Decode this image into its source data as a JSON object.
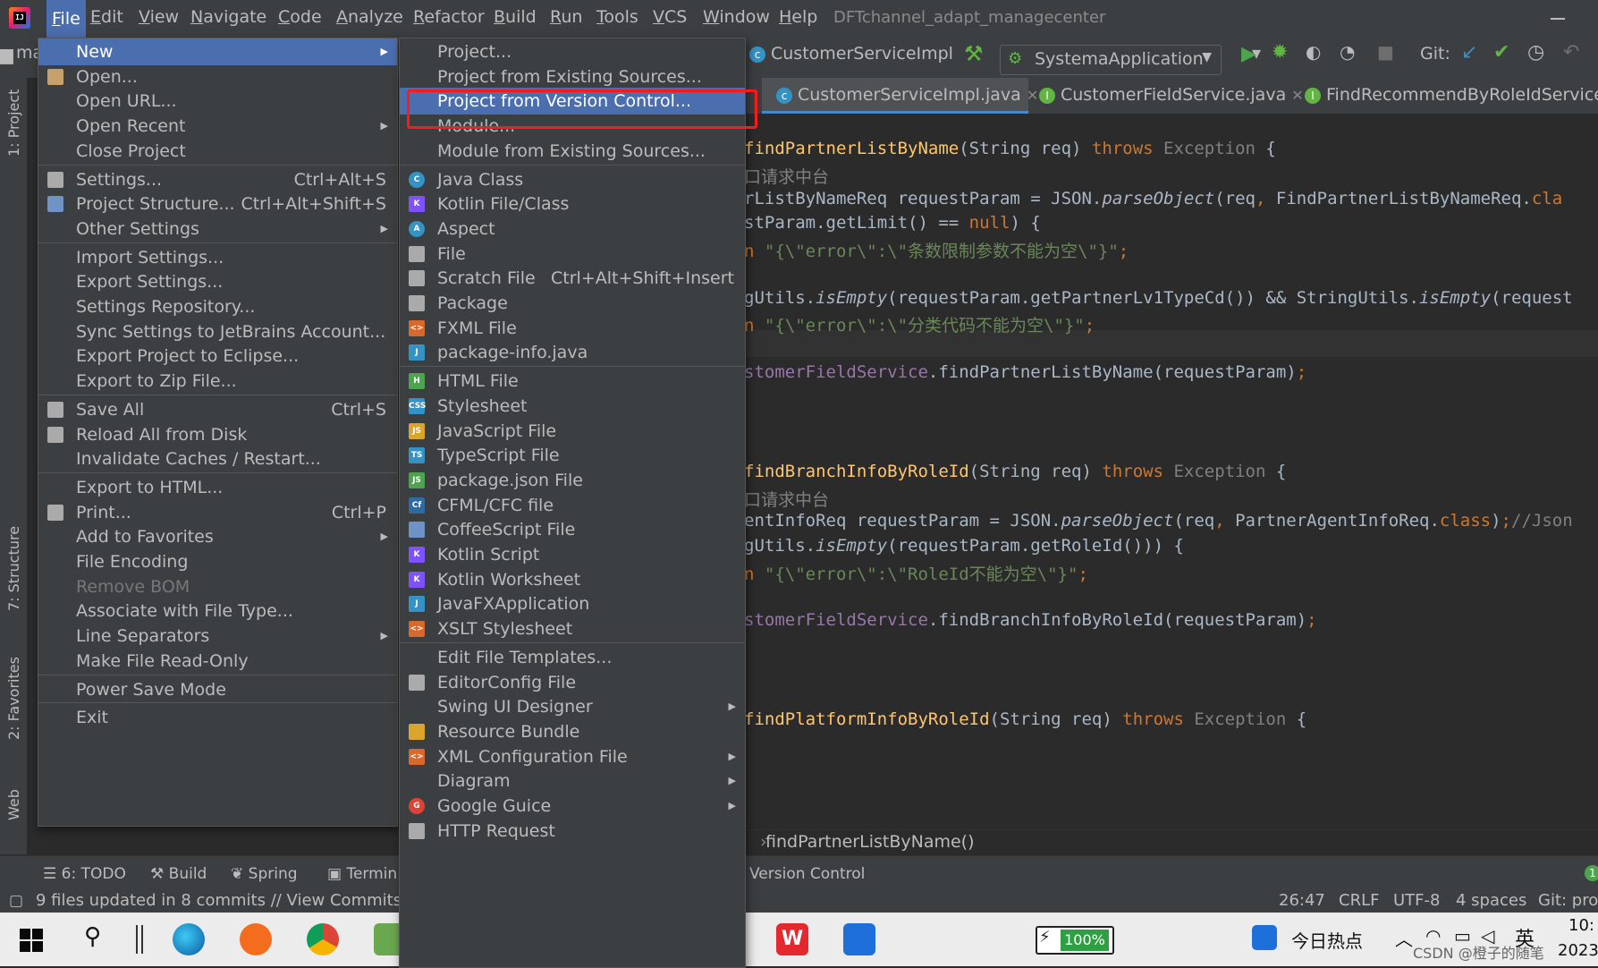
{
  "window": {
    "project_title": "DFTchannel_adapt_managecenter",
    "menus": [
      "File",
      "Edit",
      "View",
      "Navigate",
      "Code",
      "Analyze",
      "Refactor",
      "Build",
      "Run",
      "Tools",
      "VCS",
      "Window",
      "Help"
    ]
  },
  "toolbar": {
    "project_crumb": "ma",
    "class_crumb": "CustomerServiceImpl",
    "run_config": "SystemaApplication",
    "git_label": "Git:"
  },
  "editor_tabs": [
    "CustomerServiceImpl.java",
    "CustomerFieldService.java",
    "FindRecommendByRoleIdService.ja"
  ],
  "file_menu": {
    "items": [
      {
        "label": "New",
        "shortcut": "",
        "submenu": true,
        "icon": ""
      },
      {
        "label": "Open...",
        "shortcut": "",
        "submenu": false,
        "icon": "folder-icon"
      },
      {
        "label": "Open URL...",
        "shortcut": "",
        "submenu": false,
        "icon": ""
      },
      {
        "label": "Open Recent",
        "shortcut": "",
        "submenu": true,
        "icon": ""
      },
      {
        "label": "Close Project",
        "shortcut": "",
        "submenu": false,
        "icon": ""
      },
      {
        "label": "Settings...",
        "shortcut": "Ctrl+Alt+S",
        "submenu": false,
        "icon": "wrench-icon"
      },
      {
        "label": "Project Structure...",
        "shortcut": "Ctrl+Alt+Shift+S",
        "submenu": false,
        "icon": "structure-icon"
      },
      {
        "label": "Other Settings",
        "shortcut": "",
        "submenu": true,
        "icon": ""
      },
      {
        "label": "Import Settings...",
        "shortcut": "",
        "submenu": false,
        "icon": ""
      },
      {
        "label": "Export Settings...",
        "shortcut": "",
        "submenu": false,
        "icon": ""
      },
      {
        "label": "Settings Repository...",
        "shortcut": "",
        "submenu": false,
        "icon": ""
      },
      {
        "label": "Sync Settings to JetBrains Account...",
        "shortcut": "",
        "submenu": false,
        "icon": ""
      },
      {
        "label": "Export Project to Eclipse...",
        "shortcut": "",
        "submenu": false,
        "icon": ""
      },
      {
        "label": "Export to Zip File...",
        "shortcut": "",
        "submenu": false,
        "icon": ""
      },
      {
        "label": "Save All",
        "shortcut": "Ctrl+S",
        "submenu": false,
        "icon": "save-icon"
      },
      {
        "label": "Reload All from Disk",
        "shortcut": "",
        "submenu": false,
        "icon": "reload-icon"
      },
      {
        "label": "Invalidate Caches / Restart...",
        "shortcut": "",
        "submenu": false,
        "icon": ""
      },
      {
        "label": "Export to HTML...",
        "shortcut": "",
        "submenu": false,
        "icon": ""
      },
      {
        "label": "Print...",
        "shortcut": "Ctrl+P",
        "submenu": false,
        "icon": "printer-icon"
      },
      {
        "label": "Add to Favorites",
        "shortcut": "",
        "submenu": true,
        "icon": ""
      },
      {
        "label": "File Encoding",
        "shortcut": "",
        "submenu": false,
        "icon": ""
      },
      {
        "label": "Remove BOM",
        "shortcut": "",
        "submenu": false,
        "icon": "",
        "disabled": true
      },
      {
        "label": "Associate with File Type...",
        "shortcut": "",
        "submenu": false,
        "icon": ""
      },
      {
        "label": "Line Separators",
        "shortcut": "",
        "submenu": true,
        "icon": ""
      },
      {
        "label": "Make File Read-Only",
        "shortcut": "",
        "submenu": false,
        "icon": ""
      },
      {
        "label": "Power Save Mode",
        "shortcut": "",
        "submenu": false,
        "icon": ""
      },
      {
        "label": "Exit",
        "shortcut": "",
        "submenu": false,
        "icon": ""
      }
    ]
  },
  "new_menu": {
    "items": [
      {
        "label": "Project...",
        "shortcut": "",
        "submenu": false,
        "icon": ""
      },
      {
        "label": "Project from Existing Sources...",
        "shortcut": "",
        "submenu": false,
        "icon": ""
      },
      {
        "label": "Project from Version Control...",
        "shortcut": "",
        "submenu": false,
        "icon": ""
      },
      {
        "label": "Module...",
        "shortcut": "",
        "submenu": false,
        "icon": ""
      },
      {
        "label": "Module from Existing Sources...",
        "shortcut": "",
        "submenu": false,
        "icon": ""
      },
      {
        "label": "Java Class",
        "shortcut": "",
        "submenu": false,
        "icon": "java-class-icon"
      },
      {
        "label": "Kotlin File/Class",
        "shortcut": "",
        "submenu": false,
        "icon": "kotlin-file-icon"
      },
      {
        "label": "Aspect",
        "shortcut": "",
        "submenu": false,
        "icon": "aspect-icon"
      },
      {
        "label": "File",
        "shortcut": "",
        "submenu": false,
        "icon": "file-icon"
      },
      {
        "label": "Scratch File",
        "shortcut": "Ctrl+Alt+Shift+Insert",
        "submenu": false,
        "icon": "scratch-file-icon"
      },
      {
        "label": "Package",
        "shortcut": "",
        "submenu": false,
        "icon": "package-icon"
      },
      {
        "label": "FXML File",
        "shortcut": "",
        "submenu": false,
        "icon": "fxml-icon"
      },
      {
        "label": "package-info.java",
        "shortcut": "",
        "submenu": false,
        "icon": "java-file-icon"
      },
      {
        "label": "HTML File",
        "shortcut": "",
        "submenu": false,
        "icon": "html-icon"
      },
      {
        "label": "Stylesheet",
        "shortcut": "",
        "submenu": false,
        "icon": "css-icon"
      },
      {
        "label": "JavaScript File",
        "shortcut": "",
        "submenu": false,
        "icon": "js-icon"
      },
      {
        "label": "TypeScript File",
        "shortcut": "",
        "submenu": false,
        "icon": "ts-icon"
      },
      {
        "label": "package.json File",
        "shortcut": "",
        "submenu": false,
        "icon": "nodejs-icon"
      },
      {
        "label": "CFML/CFC file",
        "shortcut": "",
        "submenu": false,
        "icon": "cfml-icon"
      },
      {
        "label": "CoffeeScript File",
        "shortcut": "",
        "submenu": false,
        "icon": "coffeescript-icon"
      },
      {
        "label": "Kotlin Script",
        "shortcut": "",
        "submenu": false,
        "icon": "kotlin-script-icon"
      },
      {
        "label": "Kotlin Worksheet",
        "shortcut": "",
        "submenu": false,
        "icon": "kotlin-worksheet-icon"
      },
      {
        "label": "JavaFXApplication",
        "shortcut": "",
        "submenu": false,
        "icon": "javafx-icon"
      },
      {
        "label": "XSLT Stylesheet",
        "shortcut": "",
        "submenu": false,
        "icon": "xslt-icon"
      },
      {
        "label": "Edit File Templates...",
        "shortcut": "",
        "submenu": false,
        "icon": ""
      },
      {
        "label": "EditorConfig File",
        "shortcut": "",
        "submenu": false,
        "icon": "gear-icon"
      },
      {
        "label": "Swing UI Designer",
        "shortcut": "",
        "submenu": true,
        "icon": ""
      },
      {
        "label": "Resource Bundle",
        "shortcut": "",
        "submenu": false,
        "icon": "resource-bundle-icon"
      },
      {
        "label": "XML Configuration File",
        "shortcut": "",
        "submenu": true,
        "icon": "xml-icon"
      },
      {
        "label": "Diagram",
        "shortcut": "",
        "submenu": true,
        "icon": ""
      },
      {
        "label": "Google Guice",
        "shortcut": "",
        "submenu": true,
        "icon": "google-icon"
      },
      {
        "label": "HTTP Request",
        "shortcut": "",
        "submenu": false,
        "icon": "http-icon"
      }
    ]
  },
  "code_lines": [
    {
      "parts": [
        [
          "fn",
          "findPartnerListByName"
        ],
        [
          "",
          "(String req) "
        ],
        [
          "kw",
          "throws "
        ],
        [
          "ex",
          "Exception"
        ],
        [
          "",
          " {"
        ]
      ]
    },
    {
      "parts": [
        [
          "cm",
          "口请求中台"
        ]
      ]
    },
    {
      "parts": [
        [
          "",
          "rListByNameReq requestParam = JSON."
        ],
        [
          "ital",
          "parseObject"
        ],
        [
          "",
          "(req"
        ],
        [
          "kw",
          ", "
        ],
        [
          "",
          "FindPartnerListByNameReq."
        ],
        [
          "kw",
          "cla"
        ]
      ]
    },
    {
      "parts": [
        [
          "",
          "stParam.getLimit() == "
        ],
        [
          "kw",
          "null"
        ],
        [
          "",
          ") {"
        ]
      ]
    },
    {
      "parts": [
        [
          "kw",
          "n "
        ],
        [
          "str",
          "\"{\\\"error\\\":\\\"条数限制参数不能为空\\\"}\""
        ],
        [
          "kw",
          ";"
        ]
      ]
    },
    {
      "parts": []
    },
    {
      "parts": [
        [
          "",
          "gUtils."
        ],
        [
          "ital",
          "isEmpty"
        ],
        [
          "",
          "(requestParam.getPartnerLv1TypeCd()) && StringUtils."
        ],
        [
          "ital",
          "isEmpty"
        ],
        [
          "",
          "(request"
        ]
      ]
    },
    {
      "parts": [
        [
          "kw",
          "n "
        ],
        [
          "str",
          "\"{\\\"error\\\":\\\"分类代码不能为空\\\"}\""
        ],
        [
          "kw",
          ";"
        ]
      ]
    },
    {
      "parts": []
    },
    {
      "parts": [
        [
          "field",
          "stomerFieldService"
        ],
        [
          "",
          ".findPartnerListByName(requestParam)"
        ],
        [
          "kw",
          ";"
        ]
      ]
    },
    {
      "parts": []
    },
    {
      "parts": []
    },
    {
      "parts": []
    },
    {
      "parts": [
        [
          "fn",
          "findBranchInfoByRoleId"
        ],
        [
          "",
          "(String req) "
        ],
        [
          "kw",
          "throws "
        ],
        [
          "ex",
          "Exception"
        ],
        [
          "",
          " {"
        ]
      ]
    },
    {
      "parts": [
        [
          "cm",
          "口请求中台"
        ]
      ]
    },
    {
      "parts": [
        [
          "",
          "entInfoReq requestParam = JSON."
        ],
        [
          "ital",
          "parseObject"
        ],
        [
          "",
          "(req"
        ],
        [
          "kw",
          ", "
        ],
        [
          "",
          "PartnerAgentInfoReq."
        ],
        [
          "kw",
          "class"
        ],
        [
          "",
          ")"
        ],
        [
          "kw",
          ";"
        ],
        [
          "cm",
          "//Json"
        ]
      ]
    },
    {
      "parts": [
        [
          "",
          "gUtils."
        ],
        [
          "ital",
          "isEmpty"
        ],
        [
          "",
          "(requestParam.getRoleId())) {"
        ]
      ]
    },
    {
      "parts": [
        [
          "kw",
          "n "
        ],
        [
          "str",
          "\"{\\\"error\\\":\\\"RoleId不能为空\\\"}\""
        ],
        [
          "kw",
          ";"
        ]
      ]
    },
    {
      "parts": []
    },
    {
      "parts": [
        [
          "field",
          "stomerFieldService"
        ],
        [
          "",
          ".findBranchInfoByRoleId(requestParam)"
        ],
        [
          "kw",
          ";"
        ]
      ]
    },
    {
      "parts": []
    },
    {
      "parts": []
    },
    {
      "parts": []
    },
    {
      "parts": [
        [
          "fn",
          "findPlatformInfoByRoleId"
        ],
        [
          "",
          "(String req) "
        ],
        [
          "kw",
          "throws "
        ],
        [
          "ex",
          "Exception"
        ],
        [
          "",
          " {"
        ]
      ]
    }
  ],
  "breadcrumb": "findPartnerListByName()",
  "left_tabs": [
    "1: Project",
    "7: Structure",
    "2: Favorites",
    "Web"
  ],
  "bottom_tools": [
    "6: TODO",
    "Build",
    "Spring",
    "Termin",
    "Version Control"
  ],
  "status": {
    "message": "9 files updated in 8 commits // View Commits (",
    "position": "26:47",
    "line_sep": "CRLF",
    "encoding": "UTF-8",
    "indent": "4 spaces",
    "git": "Git: proj"
  },
  "taskbar": {
    "battery": "100%",
    "news": "今日热点",
    "lang": "英",
    "clock_time": "10:",
    "clock_date": "2023,",
    "watermark": "CSDN @橙子的随笔"
  }
}
